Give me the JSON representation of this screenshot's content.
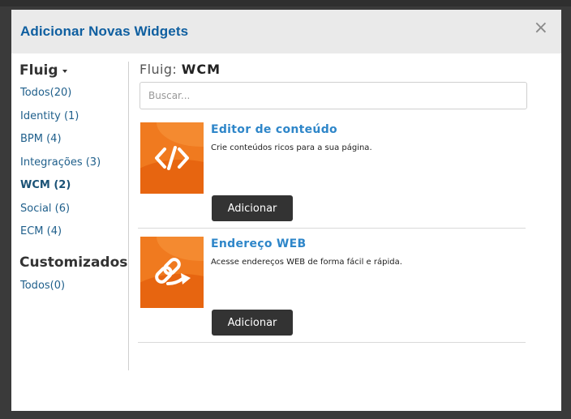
{
  "modal": {
    "title": "Adicionar Novas Widgets",
    "close_label": "×"
  },
  "sidebar": {
    "group1_title": "Fluig",
    "items": [
      {
        "label": "Todos(20)"
      },
      {
        "label": "Identity (1)"
      },
      {
        "label": "BPM (4)"
      },
      {
        "label": "Integrações (3)"
      },
      {
        "label": "WCM (2)",
        "active": true
      },
      {
        "label": "Social (6)"
      },
      {
        "label": "ECM (4)"
      }
    ],
    "group2_title": "Customizados",
    "items2": [
      {
        "label": "Todos(0)"
      }
    ]
  },
  "main": {
    "crumb_prefix": "Fluig:",
    "crumb_current": "WCM",
    "search_placeholder": "Buscar...",
    "widgets": [
      {
        "title": "Editor de conteúdo",
        "description": "Crie conteúdos ricos para a sua página.",
        "button_label": "Adicionar",
        "icon": "code-icon"
      },
      {
        "title": "Endereço WEB",
        "description": "Acesse endereços WEB de forma fácil e rápida.",
        "button_label": "Adicionar",
        "icon": "link-arrow-icon"
      }
    ]
  },
  "colors": {
    "title_blue": "#0f5fa0",
    "link_blue": "#1f5f8b",
    "widget_title": "#2e86c9",
    "icon_orange": "#f07a1f",
    "button_dark": "#333333"
  }
}
